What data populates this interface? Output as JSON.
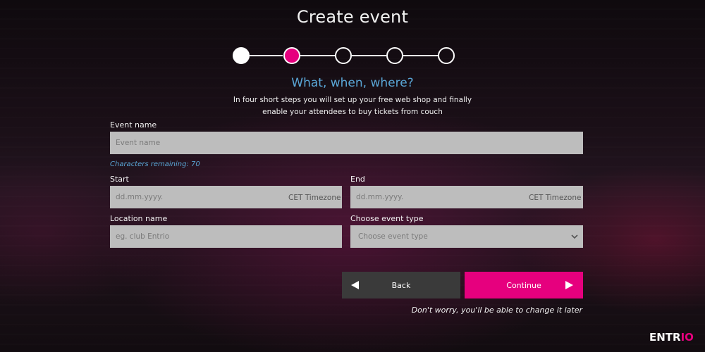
{
  "page": {
    "title": "Create event",
    "subtitle": "What, when, where?",
    "intro_line1": "In four short steps you will set up your free web shop and finally",
    "intro_line2": "enable your attendees to buy tickets from couch"
  },
  "stepper": {
    "total_steps": 5,
    "completed_steps": 1,
    "current_step": 2,
    "colors": {
      "done": "#ffffff",
      "active": "#e6007e",
      "pending": "transparent"
    }
  },
  "form": {
    "event_name": {
      "label": "Event name",
      "placeholder": "Event name",
      "value": "",
      "remaining": "Characters remaining: 70"
    },
    "start": {
      "label": "Start",
      "placeholder": "dd.mm.yyyy.",
      "value": "",
      "timezone": "CET Timezone"
    },
    "end": {
      "label": "End",
      "placeholder": "dd.mm.yyyy.",
      "value": "",
      "timezone": "CET Timezone"
    },
    "location": {
      "label": "Location name",
      "placeholder": "eg. club Entrio",
      "value": ""
    },
    "event_type": {
      "label": "Choose event type",
      "selected": "Choose event type"
    }
  },
  "actions": {
    "back_label": "Back",
    "continue_label": "Continue",
    "note": "Don't worry, you'll be able to change it later"
  },
  "brand": {
    "logo_text_a": "ENTR",
    "logo_text_b": "IO",
    "accent": "#e6007e",
    "link": "#5aa6d6"
  }
}
